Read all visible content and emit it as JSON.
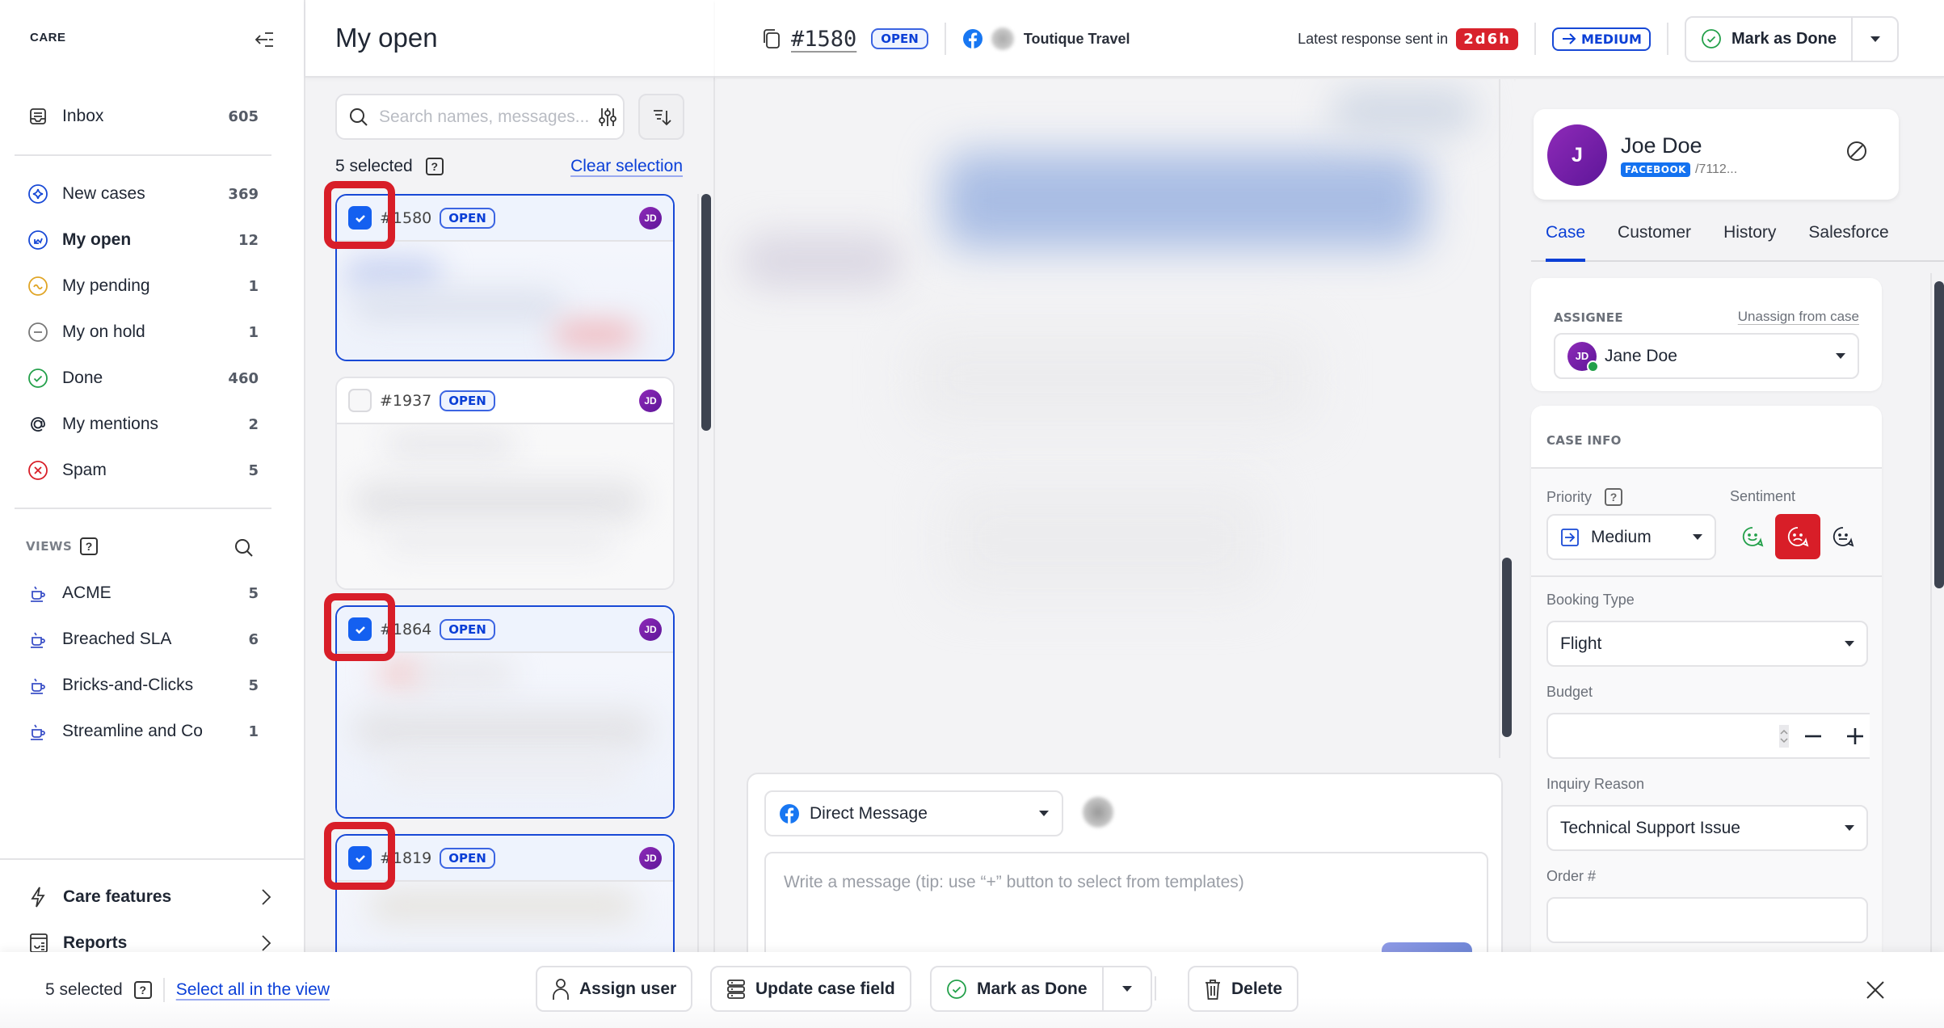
{
  "sidebar": {
    "brand": "CARE",
    "inbox": {
      "label": "Inbox",
      "count": "605"
    },
    "items": [
      {
        "label": "New cases",
        "count": "369",
        "icon": "sparkle-circle-icon",
        "color": "#1849d6"
      },
      {
        "label": "My open",
        "count": "12",
        "icon": "open-arrow-circle-icon",
        "color": "#1849d6",
        "active": true
      },
      {
        "label": "My pending",
        "count": "1",
        "icon": "pending-circle-icon",
        "color": "#e0a526"
      },
      {
        "label": "My on hold",
        "count": "1",
        "icon": "minus-circle-icon",
        "color": "#777"
      },
      {
        "label": "Done",
        "count": "460",
        "icon": "check-circle-icon",
        "color": "#23a04a"
      },
      {
        "label": "My mentions",
        "count": "2",
        "icon": "at-icon",
        "color": "#1f2633"
      },
      {
        "label": "Spam",
        "count": "5",
        "icon": "x-circle-icon",
        "color": "#d81e28"
      }
    ],
    "views_label": "VIEWS",
    "views": [
      {
        "label": "ACME",
        "count": "5"
      },
      {
        "label": "Breached SLA",
        "count": "6"
      },
      {
        "label": "Bricks-and-Clicks",
        "count": "5"
      },
      {
        "label": "Streamline and Co",
        "count": "1"
      }
    ],
    "footer": [
      {
        "label": "Care features"
      },
      {
        "label": "Reports"
      }
    ]
  },
  "list": {
    "title": "My open",
    "search_placeholder": "Search names, messages...",
    "selected_count": "5 selected",
    "clear_label": "Clear selection",
    "help": "?",
    "cards": [
      {
        "id": "#1580",
        "status": "OPEN",
        "assignee": "JD",
        "selected": true
      },
      {
        "id": "#1937",
        "status": "OPEN",
        "assignee": "JD",
        "selected": false
      },
      {
        "id": "#1864",
        "status": "OPEN",
        "assignee": "JD",
        "selected": true
      },
      {
        "id": "#1819",
        "status": "OPEN",
        "assignee": "JD",
        "selected": true
      }
    ]
  },
  "header": {
    "case_id": "#1580",
    "status": "OPEN",
    "customer_brand": "Toutique Travel",
    "latest_label": "Latest response sent in",
    "sla": "2d6h",
    "priority": "MEDIUM",
    "mark_done": "Mark as Done"
  },
  "composer": {
    "channel": "Direct Message",
    "placeholder": "Write a message (tip: use “+” button to select from templates)"
  },
  "profile": {
    "initial": "J",
    "name": "Joe Doe",
    "platform": "FACEBOOK",
    "handle": "/7112..."
  },
  "tabs": [
    "Case",
    "Customer",
    "History",
    "Salesforce"
  ],
  "assignee": {
    "label": "ASSIGNEE",
    "unassign": "Unassign from case",
    "initials": "JD",
    "name": "Jane Doe"
  },
  "case_info": {
    "label": "CASE INFO",
    "priority_label": "Priority",
    "priority_value": "Medium",
    "sentiment_label": "Sentiment",
    "sentiment_selected": "negative",
    "booking_label": "Booking Type",
    "booking_value": "Flight",
    "budget_label": "Budget",
    "budget_value": "",
    "inquiry_label": "Inquiry Reason",
    "inquiry_value": "Technical Support Issue",
    "order_label": "Order #",
    "order_value": ""
  },
  "bulk": {
    "selected": "5 selected",
    "help": "?",
    "select_all": "Select all in the view",
    "assign": "Assign user",
    "update": "Update case field",
    "done": "Mark as Done",
    "delete": "Delete"
  },
  "colors": {
    "accent": "#0b3fd6",
    "checkbox": "#1460f0",
    "sla": "#d81e28",
    "highlight": "#d81e28",
    "avatar": "#7b22a8"
  }
}
